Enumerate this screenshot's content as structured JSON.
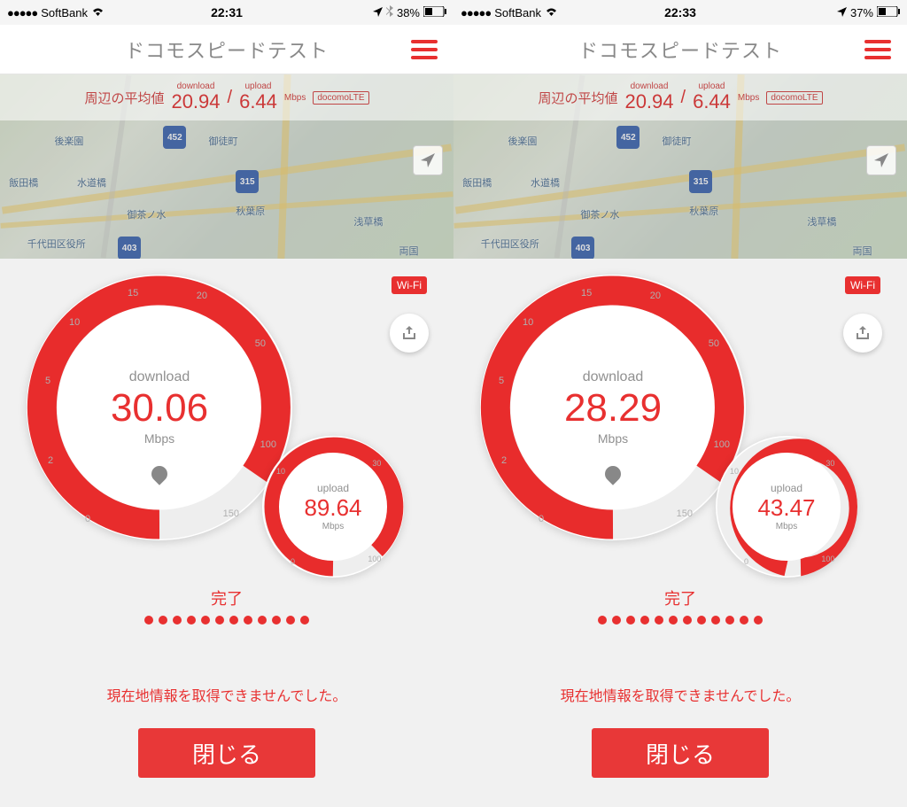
{
  "screens": [
    {
      "status": {
        "carrier": "SoftBank",
        "time": "22:31",
        "battery": "38%"
      },
      "gauge": {
        "download": "30.06",
        "upload": "89.64"
      }
    },
    {
      "status": {
        "carrier": "SoftBank",
        "time": "22:33",
        "battery": "37%"
      },
      "gauge": {
        "download": "28.29",
        "upload": "43.47"
      }
    }
  ],
  "app": {
    "title": "ドコモスピードテスト"
  },
  "avg": {
    "label": "周辺の平均値",
    "download_label": "download",
    "download": "20.94",
    "upload_label": "upload",
    "upload": "6.44",
    "unit": "Mbps",
    "network": "docomoLTE"
  },
  "map": {
    "stations": [
      "飯田橋",
      "水道橋",
      "御茶ノ水",
      "秋葉原",
      "浅草橋",
      "両国",
      "千代田区役所",
      "御徒町",
      "後楽園"
    ],
    "shields": [
      "452",
      "315",
      "403"
    ]
  },
  "result": {
    "wifi_badge": "Wi-Fi",
    "download_label": "download",
    "upload_label": "upload",
    "unit": "Mbps",
    "big_ticks": [
      "0",
      "2",
      "5",
      "10",
      "15",
      "20",
      "50",
      "100",
      "150"
    ],
    "small_ticks": [
      "0",
      "10",
      "30",
      "100"
    ],
    "status": "完了",
    "error": "現在地情報を取得できませんでした。",
    "close": "閉じる"
  }
}
